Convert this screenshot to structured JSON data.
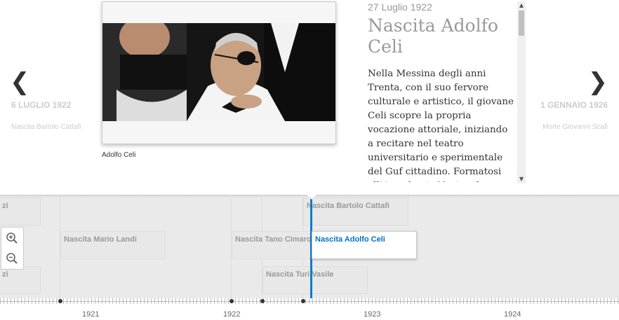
{
  "slider": {
    "prev": {
      "date": "6 LUGLIO 1922",
      "title": "Nascita Bartolo Cattafi"
    },
    "next": {
      "date": "1 GENNAIO 1926",
      "title": "Morte Giovanni Scafi"
    },
    "current": {
      "date": "27 Luglio 1922",
      "headline": "Nascita Adolfo Celi",
      "caption": "Adolfo Celi",
      "body": "Nella Messina degli anni Trenta, con il suo fervore culturale e artistico, il giovane Celi scopre la propria vocazione attoriale, iniziando a recitare nel teatro universitario e sperimentale del Guf cittadino. Formatosi all’Accademia Nazionale d’Arte Drammatica"
    }
  },
  "timeline": {
    "markers": [
      {
        "label": "zi"
      },
      {
        "label": "zi"
      },
      {
        "label": "Nascita Mario Landi"
      },
      {
        "label": "Nascita Tano Cimaro"
      },
      {
        "label": "Nascita Bartolo Cattafi"
      },
      {
        "label": "Nascita Turi Vasile"
      },
      {
        "label": "Nascita Adolfo Celi"
      }
    ],
    "years": [
      "1921",
      "1922",
      "1923",
      "1924"
    ]
  },
  "icons": {
    "prev": "chevron-left-icon",
    "next": "chevron-right-icon",
    "zoom_in": "zoom-in-icon",
    "zoom_out": "zoom-out-icon"
  },
  "colors": {
    "accent": "#0e7acb",
    "active_text": "#0072c6"
  }
}
